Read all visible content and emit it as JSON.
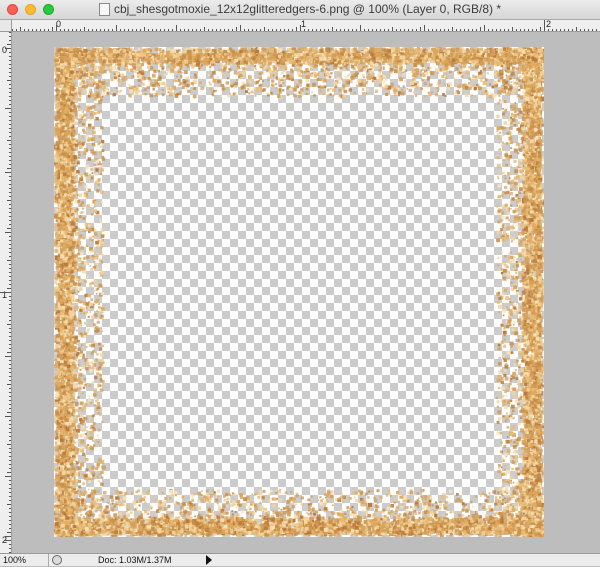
{
  "window": {
    "title": "cbj_shesgotmoxie_12x12glitteredgers-6.png @ 100% (Layer 0, RGB/8) *"
  },
  "rulers": {
    "horizontal": [
      "0",
      "1",
      "2"
    ],
    "vertical": [
      "0",
      "1",
      "2"
    ]
  },
  "colors": {
    "glitter": [
      "#d9a35a",
      "#e9bc76",
      "#c88f45",
      "#f3d39a",
      "#b9793a",
      "#f7e2b8",
      "#e0ac62",
      "#cf9a55"
    ],
    "checker_light": "#ffffff",
    "checker_dark": "#cccccc",
    "pasteboard": "#bdbdbd"
  },
  "statusbar": {
    "zoom": "100%",
    "doc_info": "Doc: 1.03M/1.37M"
  },
  "icons": {
    "document": "document-icon",
    "status_menu": "status-menu-arrow-icon",
    "status_toggle": "status-toggle-icon"
  }
}
